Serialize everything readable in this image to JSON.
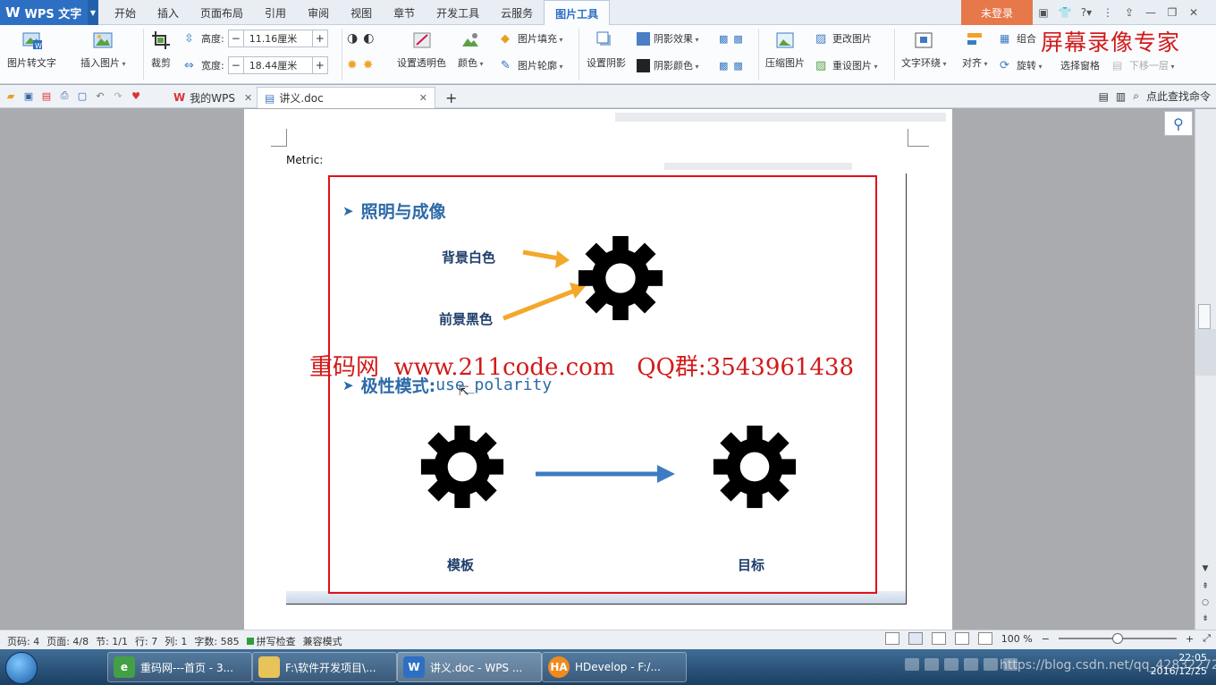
{
  "app": {
    "name": "WPS 文字"
  },
  "menu": {
    "items": [
      "开始",
      "插入",
      "页面布局",
      "引用",
      "审阅",
      "视图",
      "章节",
      "开发工具",
      "云服务",
      "图片工具"
    ],
    "active": "图片工具"
  },
  "titlebar": {
    "login": "未登录"
  },
  "watermark": {
    "top": "屏幕录像专家",
    "middle": "重码网  www.211code.com   QQ群:3543961438"
  },
  "ribbon": {
    "pic_to_text": "图片转文字",
    "insert_pic": "插入图片",
    "crop": "裁剪",
    "height_label": "高度:",
    "height_value": "11.16厘米",
    "width_label": "宽度:",
    "width_value": "18.44厘米",
    "set_transparent": "设置透明色",
    "color": "颜色",
    "pic_fill": "图片填充",
    "pic_outline": "图片轮廓",
    "set_shadow": "设置阴影",
    "shadow_effect": "阴影效果",
    "shadow_color": "阴影颜色",
    "compress": "压缩图片",
    "change_pic": "更改图片",
    "reset_pic": "重设图片",
    "wrap": "文字环绕",
    "align": "对齐",
    "group": "组合",
    "rotate": "旋转",
    "selection_pane": "选择窗格",
    "send_backward": "下移一层"
  },
  "tabs": {
    "my_wps": "我的WPS",
    "doc": "讲义.doc",
    "find": "点此查找命令"
  },
  "document": {
    "metric_label": "Metric:",
    "slide": {
      "heading1": "照明与成像",
      "bg_label": "背景白色",
      "fg_label": "前景黑色",
      "heading2_prefix": "极性模式: ",
      "heading2_code": "use_polarity",
      "template_label": "模板",
      "target_label": "目标"
    }
  },
  "status": {
    "page_code": "页码: 4",
    "page": "页面: 4/8",
    "section": "节: 1/1",
    "row": "行: 7",
    "col": "列: 1",
    "words": "字数: 585",
    "spell": "拼写检查",
    "compat": "兼容模式",
    "zoom": "100 %",
    "zoom_fraction": 0.5
  },
  "taskbar": {
    "items": [
      "重码网---首页 - 3...",
      "F:\\软件开发项目\\...",
      "讲义.doc - WPS ...",
      "HDevelop - F:/..."
    ],
    "time": "22:05",
    "date": "2016/12/25",
    "blog_watermark": "https://blog.csdn.net/qq_42832272"
  },
  "colors": {
    "accent": "#2d6fc2",
    "login": "#e6784a",
    "frame": "#e0101a",
    "heading": "#2d6aa9",
    "arrow_orange": "#f3a82a",
    "arrow_blue": "#3e7cc2"
  }
}
